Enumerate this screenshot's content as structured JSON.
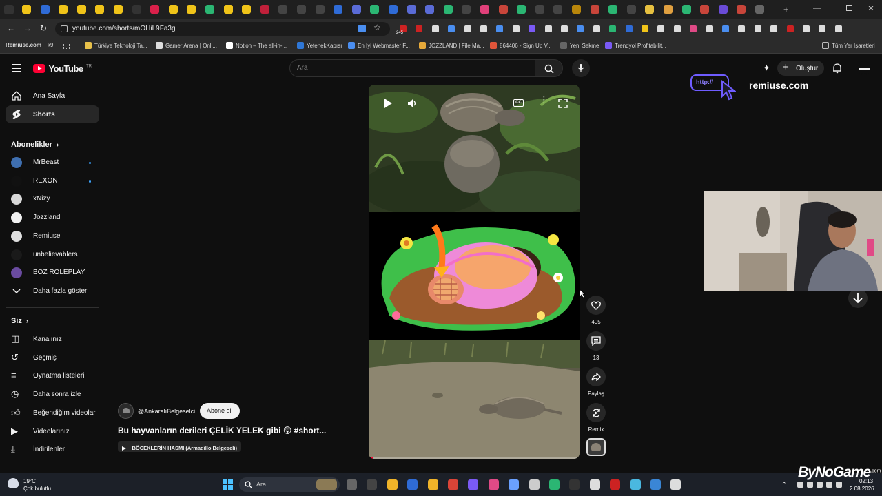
{
  "browser": {
    "url": "youtube.com/shorts/mOHiL9Fa3g",
    "extension_badge": "245",
    "bookmarks": [
      {
        "label": "Remiuse.com"
      },
      {
        "label": "k9"
      },
      {
        "label": "Türkiye Teknoloji Ta..."
      },
      {
        "label": "Gamer Arena | Onli..."
      },
      {
        "label": "Notion – The all-in-..."
      },
      {
        "label": "YetenekKapısı"
      },
      {
        "label": "En İyi Webmaster F..."
      },
      {
        "label": "JOZZLAND | File Ma..."
      },
      {
        "label": "864406 - Sign Up V..."
      },
      {
        "label": "Yeni Sekme"
      },
      {
        "label": "Trendyol Profitabilit..."
      }
    ],
    "all_bookmarks_label": "Tüm Yer İşaretleri"
  },
  "youtube": {
    "logo_text": "YouTube",
    "logo_country": "TR",
    "search_placeholder": "Ara",
    "create_label": "Oluştur",
    "sidebar": {
      "home_label": "Ana Sayfa",
      "shorts_label": "Shorts",
      "subscriptions_title": "Abonelikler",
      "subscriptions": [
        {
          "name": "MrBeast",
          "new": true
        },
        {
          "name": "REXON",
          "new": true
        },
        {
          "name": "xNizy",
          "new": false
        },
        {
          "name": "Jozzland",
          "new": false
        },
        {
          "name": "Remiuse",
          "new": false
        },
        {
          "name": "unbelievablers",
          "new": false
        },
        {
          "name": "BOZ ROLEPLAY",
          "new": false
        }
      ],
      "show_more_label": "Daha fazla göster",
      "you_title": "Siz",
      "you_items": [
        {
          "label": "Kanalınız",
          "icon": "channel-icon"
        },
        {
          "label": "Geçmiş",
          "icon": "history-icon"
        },
        {
          "label": "Oynatma listeleri",
          "icon": "playlist-icon"
        },
        {
          "label": "Daha sonra izle",
          "icon": "clock-icon"
        },
        {
          "label": "Beğendiğim videolar",
          "icon": "thumbs-up-icon"
        },
        {
          "label": "Videolarınız",
          "icon": "video-icon"
        },
        {
          "label": "İndirilenler",
          "icon": "download-icon"
        }
      ]
    },
    "short": {
      "channel": "@AnkaralıBelgeselci",
      "subscribe_label": "Abone ol",
      "title": "Bu hayvanların derileri ÇELİK YELEK gibi 😲 #short...",
      "playlist_label": "BÖCEKLERİN HASMI (Armadillo Belgeseli)",
      "likes": "405",
      "comments": "13",
      "share_label": "Paylaş",
      "remix_label": "Remix",
      "progress": 0.02
    },
    "overlay": {
      "brand_text": "remiuse.com",
      "http_text": "http://"
    }
  },
  "taskbar": {
    "weather_temp": "19°C",
    "weather_desc": "Çok bulutlu",
    "search_label": "Ara",
    "time": "02:13",
    "date": "2.08.2026",
    "watermark": "ByNoGame",
    "watermark_small": ".com"
  }
}
